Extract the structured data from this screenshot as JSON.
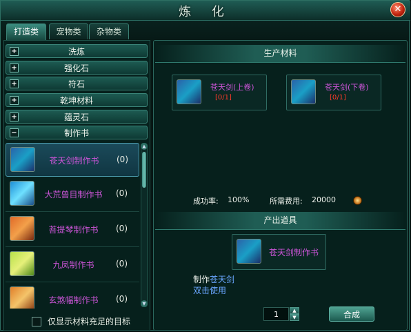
{
  "window": {
    "title": "炼 化",
    "close_label": "✕"
  },
  "tabs": [
    {
      "label": "打造类",
      "active": true
    },
    {
      "label": "宠物类",
      "active": false
    },
    {
      "label": "杂物类",
      "active": false
    }
  ],
  "categories": [
    {
      "label": "洗炼",
      "toggle": "+"
    },
    {
      "label": "强化石",
      "toggle": "+"
    },
    {
      "label": "符石",
      "toggle": "+"
    },
    {
      "label": "乾坤材料",
      "toggle": "+"
    },
    {
      "label": "蕴灵石",
      "toggle": "+"
    },
    {
      "label": "制作书",
      "toggle": "−"
    }
  ],
  "items": [
    {
      "name": "苍天剑制作书",
      "count": "(0)",
      "icon": "book-icon"
    },
    {
      "name": "大荒兽目制作书",
      "count": "(0)",
      "icon": "book-icon"
    },
    {
      "name": "菩提琴制作书",
      "count": "(0)",
      "icon": "book-icon"
    },
    {
      "name": "九凤制作书",
      "count": "(0)",
      "icon": "book-icon"
    },
    {
      "name": "玄煞幅制作书",
      "count": "(0)",
      "icon": "book-icon"
    }
  ],
  "filter": {
    "label": "仅显示材料充足的目标",
    "checked": false
  },
  "materials": {
    "header": "生产材料",
    "list": [
      {
        "name": "苍天剑(上卷)",
        "count": "[0/1]"
      },
      {
        "name": "苍天剑(下卷)",
        "count": "[0/1]"
      }
    ]
  },
  "stats": {
    "success_label": "成功率:",
    "success_value": "100%",
    "cost_label": "所需费用:",
    "cost_value": "20000"
  },
  "output": {
    "header": "产出道具",
    "item_name": "苍天剑制作书",
    "desc_prefix": "制作",
    "desc_target": "苍天剑",
    "desc_line2": "双击使用"
  },
  "quantity": {
    "value": "1",
    "up": "▲",
    "down": "▼"
  },
  "craft_button": {
    "label": "合成"
  },
  "colors": {
    "item_name": "#cc55d8",
    "count_red": "#ff3a2a",
    "desc_blue": "#6aa6ff"
  }
}
